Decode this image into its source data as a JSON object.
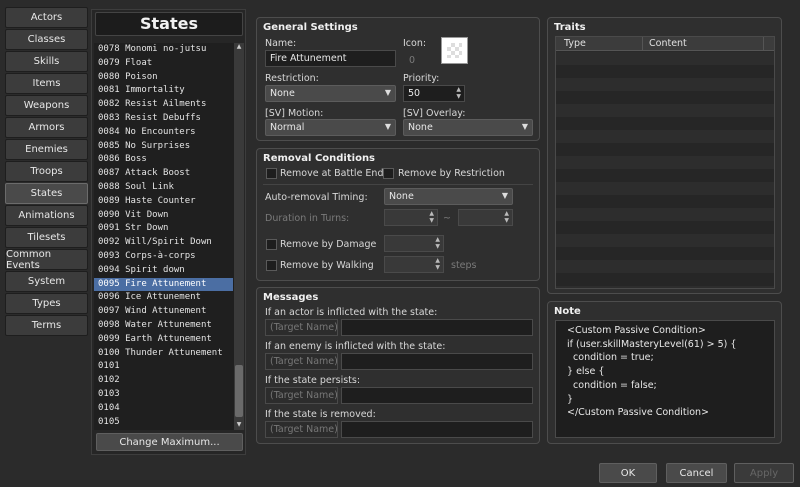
{
  "sidebar": {
    "tabs": [
      "Actors",
      "Classes",
      "Skills",
      "Items",
      "Weapons",
      "Armors",
      "Enemies",
      "Troops",
      "States",
      "Animations",
      "Tilesets",
      "Common Events",
      "System",
      "Types",
      "Terms"
    ],
    "active": "States"
  },
  "list": {
    "title": "States",
    "change_max": "Change Maximum...",
    "selected": "0095 Fire Attunement",
    "items": [
      "0078 Monomi no-jutsu",
      "0079 Float",
      "0080 Poison",
      "0081 Immortality",
      "0082 Resist Ailments",
      "0083 Resist Debuffs",
      "0084 No Encounters",
      "0085 No Surprises",
      "0086 Boss",
      "0087 Attack Boost",
      "0088 Soul Link",
      "0089 Haste Counter",
      "0090 Vit Down",
      "0091 Str Down",
      "0092 Will/Spirit Down",
      "0093 Corps-à-corps",
      "0094 Spirit down",
      "0095 Fire Attunement",
      "0096 Ice Attunement",
      "0097 Wind Attunement",
      "0098 Water Attunement",
      "0099 Earth Attunement",
      "0100 Thunder Attunement",
      "0101",
      "0102",
      "0103",
      "0104",
      "0105"
    ]
  },
  "general": {
    "title": "General Settings",
    "name_label": "Name:",
    "name_value": "Fire Attunement",
    "icon_label": "Icon:",
    "icon_index": "0",
    "restriction_label": "Restriction:",
    "restriction_value": "None",
    "priority_label": "Priority:",
    "priority_value": "50",
    "motion_label": "[SV] Motion:",
    "motion_value": "Normal",
    "overlay_label": "[SV] Overlay:",
    "overlay_value": "None"
  },
  "removal": {
    "title": "Removal Conditions",
    "battle_end": "Remove at Battle End",
    "restriction": "Remove by Restriction",
    "timing_label": "Auto-removal Timing:",
    "timing_value": "None",
    "duration_label": "Duration in Turns:",
    "tilde": "~",
    "damage": "Remove by Damage",
    "walking": "Remove by Walking",
    "steps": "steps"
  },
  "messages": {
    "title": "Messages",
    "placeholder": "(Target Name)",
    "rows": [
      "If an actor is inflicted with the state:",
      "If an enemy is inflicted with the state:",
      "If the state persists:",
      "If the state is removed:"
    ]
  },
  "traits": {
    "title": "Traits",
    "col_type": "Type",
    "col_content": "Content"
  },
  "note": {
    "title": "Note",
    "lines": [
      "<Custom Passive Condition>",
      "if (user.skillMasteryLevel(61) > 5) {",
      "  condition = true;",
      "} else {",
      "  condition = false;",
      "}",
      "</Custom Passive Condition>"
    ]
  },
  "footer": {
    "ok": "OK",
    "cancel": "Cancel",
    "apply": "Apply"
  }
}
